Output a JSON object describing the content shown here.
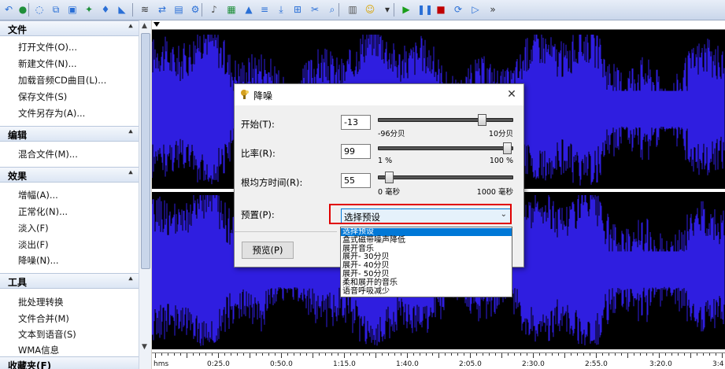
{
  "toolbar": {
    "icons": [
      "undo-icon",
      "record-icon",
      "effects-icon",
      "copy-icon",
      "paste-icon",
      "mix-icon",
      "normalize-icon",
      "fade-icon",
      "wave-icon",
      "stereo-icon",
      "save-icon",
      "settings-icon",
      "pitch-icon",
      "equalizer-icon",
      "amplify-icon",
      "trim-icon",
      "split-icon",
      "join-icon",
      "cut-icon",
      "zoom-icon",
      "calendar-icon",
      "person-icon",
      "dropdown-icon",
      "play-icon",
      "pause-icon",
      "stop-icon",
      "loop-icon",
      "play-selection-icon",
      "more-icon"
    ]
  },
  "sidebar": {
    "sections": [
      {
        "title": "文件",
        "items": [
          "打开文件(O)...",
          "新建文件(N)...",
          "加载音频CD曲目(L)...",
          "保存文件(S)",
          "文件另存为(A)..."
        ]
      },
      {
        "title": "编辑",
        "items": [
          "混合文件(M)..."
        ]
      },
      {
        "title": "效果",
        "items": [
          "增幅(A)...",
          "正常化(N)...",
          "淡入(F)",
          "淡出(F)",
          "降噪(N)..."
        ]
      },
      {
        "title": "工具",
        "items": [
          "批处理转换",
          "文件合并(M)",
          "文本到语音(S)",
          "WMA信息"
        ]
      },
      {
        "title": "收藏夹(F)",
        "items": []
      }
    ]
  },
  "waveform": {
    "color": "#2f1ee0",
    "background": "#000000"
  },
  "timeline": {
    "labels": [
      "hms",
      "0:25.0",
      "0:50.0",
      "1:15.0",
      "1:40.0",
      "2:05.0",
      "2:30.0",
      "2:55.0",
      "3:20.0",
      "3:4"
    ]
  },
  "dialog": {
    "title": "降噪",
    "start": {
      "label": "开始(T):",
      "value": "-13",
      "min_label": "-96分贝",
      "max_label": "10分贝",
      "level": 0.79
    },
    "ratio": {
      "label": "比率(R):",
      "value": "99",
      "min_label": "1 %",
      "max_label": "100 %",
      "level": 0.99
    },
    "rms": {
      "label": "根均方时间(R):",
      "value": "55",
      "min_label": "0 毫秒",
      "max_label": "1000 毫秒",
      "level": 0.055
    },
    "preset_label": "预置(P):",
    "preset_value": "选择预设",
    "preview_button": "预览(P)",
    "presets": [
      "选择预设",
      "盒式磁带噪声降低",
      "展开音乐",
      "展开- 30分贝",
      "展开- 40分贝",
      "展开- 50分贝",
      "柔和展开的音乐",
      "语音呼吸减少"
    ],
    "selected_preset": 0,
    "highlight_color": "#e00000"
  }
}
